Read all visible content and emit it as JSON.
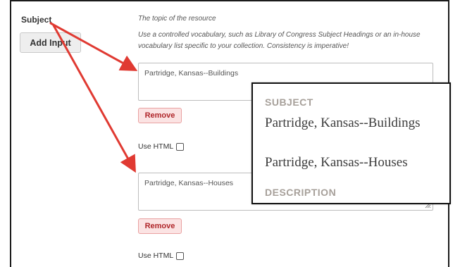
{
  "field": {
    "label": "Subject",
    "add_input_label": "Add Input",
    "explanation_1": "The topic of the resource",
    "explanation_2": "Use a controlled vocabulary, such as Library of Congress Subject Headings or an in-house vocabulary list specific to your collection. Consistency is imperative!"
  },
  "inputs": [
    {
      "value": "Partridge, Kansas--Buildings",
      "remove_label": "Remove",
      "use_html_label": "Use HTML",
      "use_html_checked": false
    },
    {
      "value": "Partridge, Kansas--Houses",
      "remove_label": "Remove",
      "use_html_label": "Use HTML",
      "use_html_checked": false
    }
  ],
  "preview": {
    "heading": "SUBJECT",
    "values": [
      "Partridge, Kansas--Buildings",
      "Partridge, Kansas--Houses"
    ],
    "next_heading": "DESCRIPTION"
  },
  "colors": {
    "arrow": "#e03a32",
    "remove_text": "#b0272b",
    "remove_bg": "#fbe3e3",
    "preview_heading": "#a7a09a"
  }
}
